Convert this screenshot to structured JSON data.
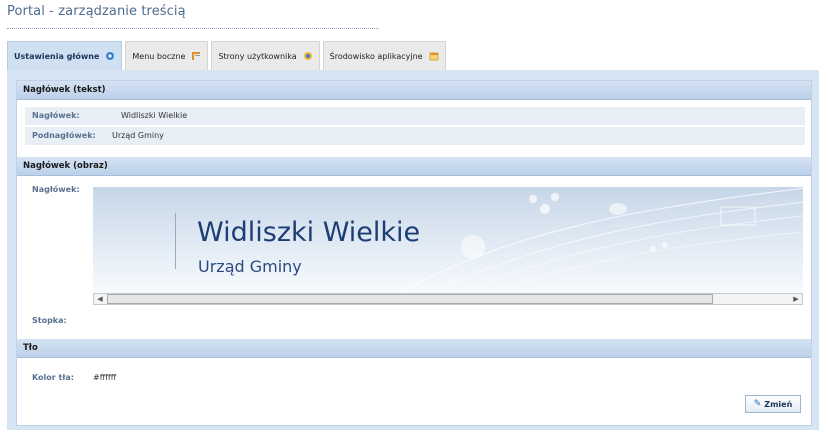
{
  "page": {
    "title": "Portal - zarządzanie treścią"
  },
  "tabs": [
    {
      "label": "Ustawienia główne",
      "icon": "settings-icon",
      "active": true
    },
    {
      "label": "Menu boczne",
      "icon": "menu-icon",
      "active": false
    },
    {
      "label": "Strony użytkownika",
      "icon": "user-pages-icon",
      "active": false
    },
    {
      "label": "Środowisko aplikacyjne",
      "icon": "app-env-icon",
      "active": false
    }
  ],
  "header_text": {
    "section": "Nagłówek (tekst)",
    "heading_label": "Nagłówek:",
    "heading_value": "Widliszki Wielkie",
    "subheading_label": "Podnagłówek:",
    "subheading_value": "Urząd Gminy"
  },
  "header_image": {
    "section": "Nagłówek (obraz)",
    "heading_label": "Nagłówek:",
    "banner_title": "Widliszki Wielkie",
    "banner_subtitle": "Urząd Gminy",
    "footer_label": "Stopka:"
  },
  "background": {
    "section": "Tło",
    "color_label": "Kolor tła:",
    "color_value": "#ffffff"
  },
  "actions": {
    "change_label": "Zmień"
  },
  "colors": {
    "accent": "#1d3e75",
    "section_header": "#c8d9ee",
    "panel_bg": "#d6e4f3"
  }
}
